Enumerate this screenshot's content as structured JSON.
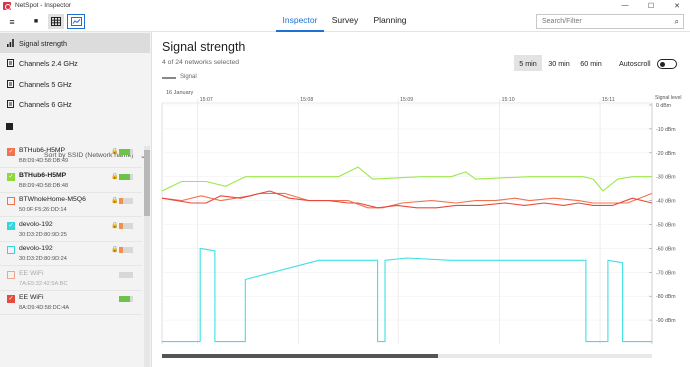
{
  "window": {
    "title": "NetSpot - Inspector",
    "min": "—",
    "max": "☐",
    "close": "✕"
  },
  "toolbar": {
    "menu_glyph": "≡",
    "stop_glyph": "■",
    "tabs": [
      {
        "label": "Inspector"
      },
      {
        "label": "Survey"
      },
      {
        "label": "Planning"
      }
    ],
    "search_placeholder": "Search/Filter",
    "search_glyph": "⌕"
  },
  "sidebar": {
    "items": [
      {
        "label": "Signal strength"
      },
      {
        "label": "Channels 2.4 GHz"
      },
      {
        "label": "Channels 5 GHz"
      },
      {
        "label": "Channels 6 GHz"
      }
    ],
    "sort_label": "Sort by SSID (Network name)",
    "sort_chevron": "⌄",
    "networks": [
      {
        "name": "BTHub6-H5MP",
        "mac": "B8:D9:4D:58:DB:49",
        "checked": true,
        "color": "#f0734f",
        "lock": true,
        "level": 0.75,
        "bar_color": "#6dc24b",
        "bold": false,
        "dim": false
      },
      {
        "name": "BTHub6-H5MP",
        "mac": "B8:D9:4D:58:DB:48",
        "checked": true,
        "color": "#8fd83a",
        "lock": true,
        "level": 0.75,
        "bar_color": "#6dc24b",
        "bold": true,
        "dim": false
      },
      {
        "name": "BTWholeHome-M5Q6",
        "mac": "50:0F:F5:26:DD:14",
        "checked": false,
        "color": "#f0734f",
        "lock": true,
        "level": 0.3,
        "bar_color": "#f0904a",
        "bold": false,
        "dim": false
      },
      {
        "name": "devolo-192",
        "mac": "30:D3:2D:80:9D:25",
        "checked": true,
        "color": "#36d6dc",
        "lock": true,
        "level": 0.3,
        "bar_color": "#f0904a",
        "bold": false,
        "dim": false
      },
      {
        "name": "devolo-192",
        "mac": "30:D3:2D:80:9D:24",
        "checked": false,
        "color": "#36d6dc",
        "lock": true,
        "level": 0.3,
        "bar_color": "#f0904a",
        "bold": false,
        "dim": false
      },
      {
        "name": "EE WiFi",
        "mac": "7A:E5:32:42:5A:BC",
        "checked": false,
        "color": "#f0a58a",
        "lock": false,
        "level": 0.0,
        "bar_color": "#cccccc",
        "bold": false,
        "dim": true
      },
      {
        "name": "EE WiFi",
        "mac": "8A:D9:4D:58:DC:4A",
        "checked": true,
        "color": "#e64a3c",
        "lock": false,
        "level": 0.75,
        "bar_color": "#6dc24b",
        "bold": false,
        "dim": false
      }
    ]
  },
  "main": {
    "title": "Signal strength",
    "subtitle": "4 of 24 networks selected",
    "legend": "Signal",
    "ranges": [
      {
        "label": "5 min",
        "active": true
      },
      {
        "label": "30 min",
        "active": false
      },
      {
        "label": "60 min",
        "active": false
      }
    ],
    "autoscroll_label": "Autoscroll",
    "autoscroll_on": false
  },
  "chart_data": {
    "type": "line",
    "date": "16 January",
    "x_ticks": [
      "15:07",
      "15:08",
      "15:09",
      "15:10",
      "15:11"
    ],
    "ylabel": "Signal level",
    "y_ticks": [
      "0 dBm",
      "-10 dBm",
      "-20 dBm",
      "-30 dBm",
      "-40 dBm",
      "-50 dBm",
      "-60 dBm",
      "-70 dBm",
      "-80 dBm",
      "-90 dBm"
    ],
    "ylim": [
      -100,
      0
    ],
    "xlim": [
      0,
      100
    ],
    "grid": true,
    "series": [
      {
        "color": "#9be84a",
        "values": [
          [
            0,
            -36
          ],
          [
            4,
            -32
          ],
          [
            9,
            -32
          ],
          [
            13,
            -34
          ],
          [
            17,
            -30
          ],
          [
            25,
            -30
          ],
          [
            34,
            -30
          ],
          [
            36,
            -30
          ],
          [
            38,
            -28
          ],
          [
            40,
            -26
          ],
          [
            43,
            -31
          ],
          [
            53,
            -30
          ],
          [
            59,
            -30
          ],
          [
            62,
            -28
          ],
          [
            64,
            -31
          ],
          [
            75,
            -30
          ],
          [
            86,
            -30
          ],
          [
            88,
            -31
          ],
          [
            90,
            -36
          ],
          [
            93,
            -31
          ],
          [
            96,
            -30
          ],
          [
            100,
            -30
          ]
        ]
      },
      {
        "color": "#f0734f",
        "values": [
          [
            0,
            -39
          ],
          [
            4,
            -40
          ],
          [
            8,
            -38
          ],
          [
            12,
            -40
          ],
          [
            18,
            -38
          ],
          [
            20,
            -37
          ],
          [
            25,
            -37
          ],
          [
            30,
            -40
          ],
          [
            34,
            -40
          ],
          [
            38,
            -40
          ],
          [
            42,
            -43
          ],
          [
            45,
            -43
          ],
          [
            49,
            -41
          ],
          [
            55,
            -40
          ],
          [
            60,
            -41
          ],
          [
            64,
            -40
          ],
          [
            68,
            -40
          ],
          [
            72,
            -39
          ],
          [
            75,
            -40
          ],
          [
            80,
            -39
          ],
          [
            85,
            -40
          ],
          [
            88,
            -41
          ],
          [
            91,
            -41
          ],
          [
            95,
            -41
          ],
          [
            100,
            -37
          ]
        ]
      },
      {
        "color": "#e64a3c",
        "values": [
          [
            0,
            -39
          ],
          [
            6,
            -41
          ],
          [
            9,
            -41
          ],
          [
            12,
            -38
          ],
          [
            16,
            -39
          ],
          [
            22,
            -36
          ],
          [
            26,
            -39
          ],
          [
            30,
            -40
          ],
          [
            34,
            -40
          ],
          [
            38,
            -41
          ],
          [
            40,
            -41
          ],
          [
            44,
            -43
          ],
          [
            48,
            -42
          ],
          [
            52,
            -43
          ],
          [
            56,
            -43
          ],
          [
            60,
            -42
          ],
          [
            65,
            -42
          ],
          [
            70,
            -41
          ],
          [
            74,
            -42
          ],
          [
            78,
            -41
          ],
          [
            82,
            -42
          ],
          [
            85,
            -41
          ],
          [
            88,
            -42
          ],
          [
            92,
            -42
          ],
          [
            96,
            -39
          ],
          [
            100,
            -41
          ]
        ]
      },
      {
        "color": "#3fe0e4",
        "values": [
          [
            0,
            -99
          ],
          [
            7.8,
            -99
          ],
          [
            7.8,
            -60
          ],
          [
            10.8,
            -61
          ],
          [
            10.8,
            -99
          ],
          [
            17,
            -99
          ],
          [
            17,
            -73
          ],
          [
            32,
            -65
          ],
          [
            44,
            -65
          ],
          [
            44,
            -99
          ],
          [
            45.5,
            -99
          ],
          [
            45.5,
            -65
          ],
          [
            50,
            -64
          ],
          [
            59,
            -65
          ],
          [
            68,
            -65
          ],
          [
            86.5,
            -65
          ],
          [
            86.5,
            -99
          ],
          [
            91,
            -99
          ],
          [
            91,
            -65
          ],
          [
            94,
            -66
          ],
          [
            94,
            -99
          ],
          [
            100,
            -99
          ]
        ]
      }
    ]
  }
}
